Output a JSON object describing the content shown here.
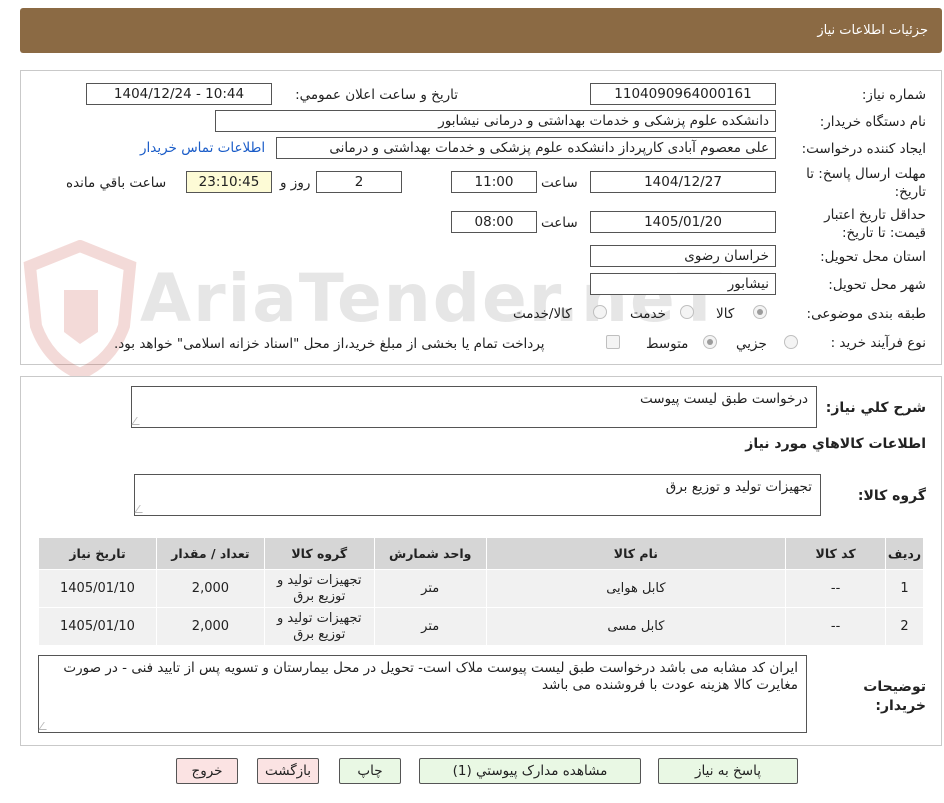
{
  "header": {
    "title": "جزئیات اطلاعات نیاز"
  },
  "form": {
    "need_number_label": "شماره نیاز:",
    "need_number": "1104090964000161",
    "announce_label": "تاریخ و ساعت اعلان عمومي:",
    "announce_value": "1404/12/24 - 10:44",
    "buyer_org_label": "نام دستگاه خريدار:",
    "buyer_org": "دانشکده علوم پزشکی و خدمات بهداشتی و درمانی نیشابور",
    "requester_label": "ايجاد کننده درخواست:",
    "requester": "علی معصوم آبادی کارپرداز دانشکده علوم پزشکی و خدمات بهداشتی و درمانی",
    "contact_link": "اطلاعات تماس خریدار",
    "deadline_label": "مهلت ارسال پاسخ: تا تاریخ:",
    "deadline_date": "1404/12/27",
    "time_label": "ساعت",
    "deadline_time": "11:00",
    "days_value": "2",
    "days_label": "روز و",
    "remaining_time": "23:10:45",
    "remaining_label": "ساعت باقي مانده",
    "validity_label": "حداقل تاريخ اعتبار قيمت: تا تاريخ:",
    "validity_date": "1405/01/20",
    "validity_time_label": "ساعت",
    "validity_time": "08:00",
    "province_label": "استان محل تحويل:",
    "province": "خراسان رضوی",
    "city_label": "شهر محل تحويل:",
    "city": "نیشابور",
    "category_label": "طبقه بندی موضوعی:",
    "category_options": [
      "کالا",
      "خدمت",
      "کالا/خدمت"
    ],
    "category_selected": "کالا",
    "process_label": "نوع فرآیند خرید :",
    "process_options": [
      "جزيي",
      "متوسط"
    ],
    "process_selected": "متوسط",
    "treasury_note": "پرداخت تمام یا بخشی از مبلغ خرید،از محل \"اسناد خزانه اسلامی\" خواهد بود."
  },
  "watermark": {
    "text": "AriaTender.neT"
  },
  "summary": {
    "label": "شرح کلي نياز:",
    "value": "درخواست طبق لیست پیوست"
  },
  "goods": {
    "section_title": "اطلاعات کالاهاي مورد نياز",
    "group_label": "گروه کالا:",
    "group_value": "تجهیزات تولید و توزیع برق"
  },
  "table": {
    "headers": [
      "رديف",
      "کد کالا",
      "نام کالا",
      "واحد شمارش",
      "گروه کالا",
      "تعداد / مقدار",
      "تاريخ نياز"
    ],
    "rows": [
      [
        "1",
        "--",
        "کابل هوایی",
        "متر",
        "تجهیزات تولید و توزیع برق",
        "2,000",
        "1405/01/10"
      ],
      [
        "2",
        "--",
        "کابل مسی",
        "متر",
        "تجهیزات تولید و توزیع برق",
        "2,000",
        "1405/01/10"
      ]
    ]
  },
  "notes": {
    "label": "توضيحات خريدار:",
    "value": "ایران کد مشابه می باشد درخواست طبق لیست پیوست ملاک است- تحویل در محل بیمارستان و تسویه پس از تایید فنی - در صورت مغایرت کالا هزینه عودت با فروشنده می باشد"
  },
  "buttons": {
    "reply": "پاسخ به نياز",
    "attachments": "مشاهده مدارک پيوستي (1)",
    "print": "چاپ",
    "back": "بازگشت",
    "exit": "خروج"
  }
}
